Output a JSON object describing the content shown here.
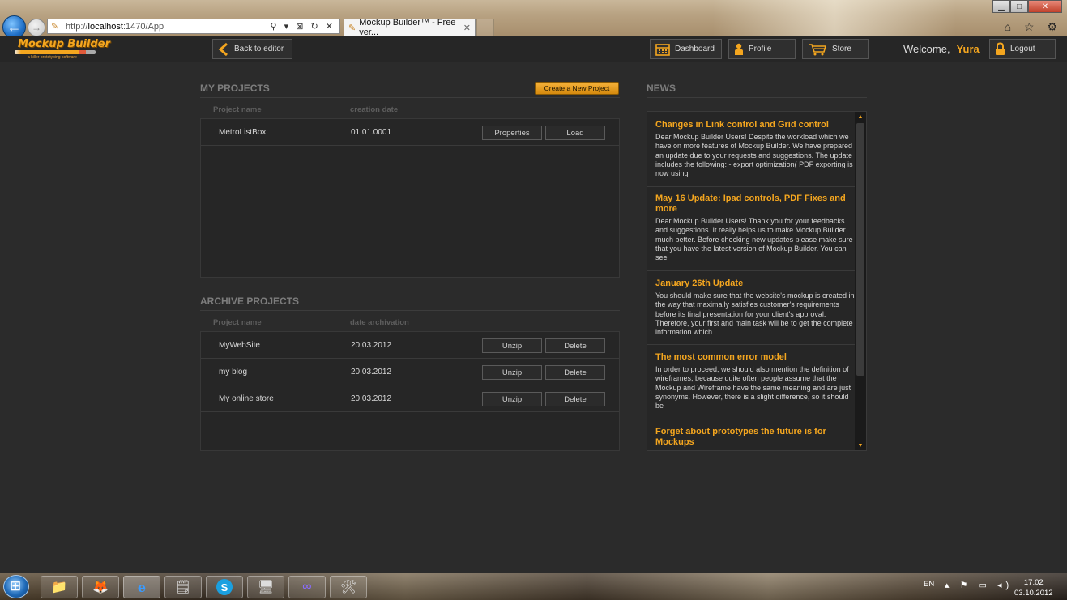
{
  "browser": {
    "url_prefix": "http://",
    "url_host": "localhost",
    "url_rest": ":1470/App",
    "address_tools": "⚲ ▾ ⊠ ↻ ✕",
    "tab_title": "Mockup Builder™ - Free ver...",
    "tab_close": "✕",
    "right_icons": "⌂ ☆ ⚙",
    "window_controls": {
      "minimize": "▁",
      "maximize": "□",
      "close": "✕"
    }
  },
  "header": {
    "logo_title": "Mockup Builder",
    "logo_tagline": "a killer prototyping software",
    "back_to_editor": "Back to editor",
    "dashboard": "Dashboard",
    "profile": "Profile",
    "store": "Store",
    "welcome": "Welcome,",
    "username": "Yura",
    "logout": "Logout"
  },
  "my_projects": {
    "title": "MY PROJECTS",
    "create_button": "Create a New Project",
    "col_name": "Project name",
    "col_date": "creation date",
    "rows": [
      {
        "name": "MetroListBox",
        "date": "01.01.0001",
        "btn1": "Properties",
        "btn2": "Load"
      }
    ]
  },
  "archive_projects": {
    "title": "ARCHIVE PROJECTS",
    "col_name": "Project name",
    "col_date": "date archivation",
    "rows": [
      {
        "name": "MyWebSite",
        "date": "20.03.2012",
        "btn1": "Unzip",
        "btn2": "Delete"
      },
      {
        "name": "my blog",
        "date": "20.03.2012",
        "btn1": "Unzip",
        "btn2": "Delete"
      },
      {
        "name": "My online store",
        "date": "20.03.2012",
        "btn1": "Unzip",
        "btn2": "Delete"
      }
    ]
  },
  "news": {
    "title": "NEWS",
    "items": [
      {
        "title": "Changes in Link control and Grid control",
        "body": "Dear Mockup Builder Users! Despite the workload which we have on more features of Mockup Builder. We have prepared an update due to your requests and suggestions. The update includes the following: - export optimization( PDF exporting is now using"
      },
      {
        "title": "May 16 Update: Ipad controls, PDF Fixes and more",
        "body": "Dear Mockup Builder Users! Thank you for your feedbacks and suggestions. It really helps us to make Mockup Builder much better. Before checking new updates please make sure that you have the latest version of Mockup Builder. You can see"
      },
      {
        "title": "January 26th Update",
        "body": "You should make sure that the website's mockup is created in the way that maximally satisfies customer's requirements before its final presentation for your client's approval. Therefore, your first and main task will be to get the complete information which"
      },
      {
        "title": "The most common error model",
        "body": "In order to proceed, we should also mention the definition of wireframes, because quite often people assume that the Mockup and Wireframe have the same meaning and are just synonyms. However, there is a slight difference, so it should be"
      },
      {
        "title": "Forget about prototypes the future is for Mockups",
        "body": ""
      }
    ]
  },
  "taskbar": {
    "language": "EN",
    "time": "17:02",
    "date": "03.10.2012"
  },
  "colors": {
    "accent": "#f4a61f",
    "background": "#2b2b2b",
    "panel": "#262626"
  }
}
